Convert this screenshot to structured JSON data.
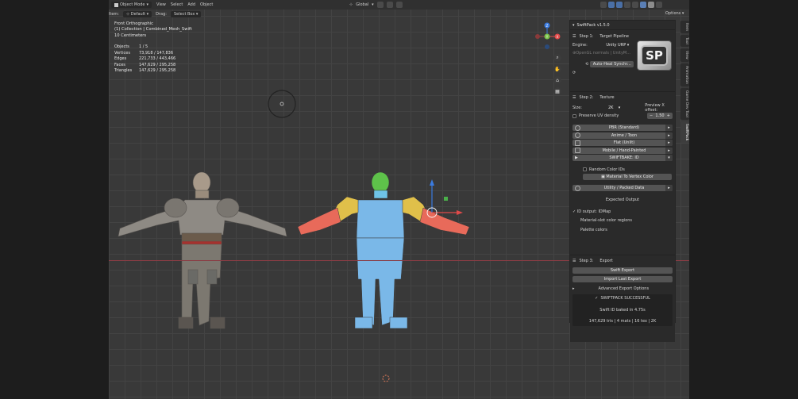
{
  "header": {
    "mode": "Object Mode",
    "menus": [
      "View",
      "Select",
      "Add",
      "Object"
    ],
    "transform": "Global",
    "options": "Options"
  },
  "header2": {
    "item_label": "ltem:",
    "orientation": "Default",
    "drag_label": "Drag:",
    "drag_value": "Select Box"
  },
  "viewport": {
    "view_name": "Front Orthographic",
    "collection": "(1) Collection | Combined_Mesh_Swift",
    "scale": "10 Centimeters",
    "stats": [
      {
        "label": "Objects",
        "value": "1 / 5"
      },
      {
        "label": "Vertices",
        "value": "73,918 / 147,836"
      },
      {
        "label": "Edges",
        "value": "221,733 / 443,466"
      },
      {
        "label": "Faces",
        "value": "147,629 / 295,258"
      },
      {
        "label": "Triangles",
        "value": "147,629 / 295,258"
      }
    ],
    "gizmo": {
      "z": "Z",
      "y": "Y",
      "x": "X"
    }
  },
  "panel": {
    "title": "SwiftPack v1.5.0",
    "step1": {
      "label": "Step 1:",
      "title": "Target Pipeline",
      "engine_label": "Engine:",
      "engine_value": "Unity URP",
      "normals": "OpenGL normals | UnityM...",
      "sync_button": "Auto-Heal Synchr..."
    },
    "logo_text": "SP",
    "step2": {
      "label": "Step 2:",
      "title": "Texture",
      "size_label": "Size:",
      "size_value": "2K",
      "preview_label": "Preview X offset:",
      "preview_value": "1.50",
      "preserve_uv": "Preserve UV density",
      "subpanels": [
        "PBR (Standard)",
        "Anime / Toon",
        "Flat (Unlit)",
        "Mobile / Hand-Painted",
        "SWIFTBAKE: ID"
      ],
      "random_ids": "Random Color IDs",
      "material_btn": "Material To Vertex Color",
      "utility": "Utility / Packed Data",
      "expected_title": "Expected Output",
      "expected": [
        "ID output: IDMap",
        "Material-slot color regions",
        "Palette colors"
      ]
    },
    "step3": {
      "label": "Step 3:",
      "title": "Export",
      "swift_export": "Swift Export",
      "import_last": "Import Last Export",
      "advanced": "Advanced Export Options",
      "success": "SWIFTPACK SUCCESSFUL",
      "baked": "Swift ID baked in 4.75s",
      "summary": "147,629 tris | 4 mats | 16 tex | 2K"
    }
  },
  "tabs": [
    "Item",
    "Tool",
    "View",
    "Animation",
    "Game Dev Tool",
    "SwiftPack"
  ]
}
